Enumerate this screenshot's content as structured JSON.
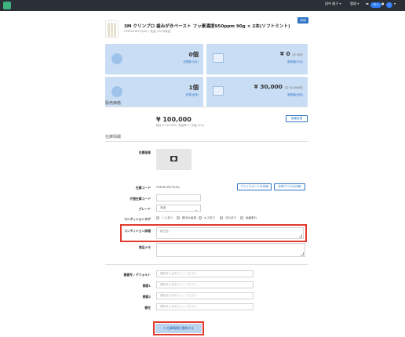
{
  "topbar": {
    "user": "田中 隆子",
    "menu": "管理",
    "badge1": "99+",
    "badge2": "1"
  },
  "product": {
    "title": "3M クリンプロ 歯みがきペースト フッ素濃度950ppm 90g × 2本(ソフトミント)",
    "sub": "ITM4DTW0TQXQ / 衣品 / EC共有品",
    "edit_label": "詳細"
  },
  "stats": [
    {
      "value": "0個",
      "label": "在庫数(今月)"
    },
    {
      "value": "¥ 0",
      "value_small": "(平 0/件)",
      "label": "販売額(今月)"
    },
    {
      "value": "1個",
      "label": "在庫(全体)"
    },
    {
      "value": "¥ 30,000",
      "value_small": "(平 30,000/件)",
      "label": "販売額(全体)"
    }
  ],
  "sections": {
    "price_title": "販売価格",
    "inventory_title": "在庫情報"
  },
  "price": {
    "amount": "¥ 100,000",
    "sub": "税込 ¥ 110,000 / 利益率 0 / 利益 (0%)",
    "change_button": "価格変更"
  },
  "fields": {
    "image_label": "在庫画像",
    "code_label": "在庫コード",
    "code_value": "ITM4DTW0TQXQ",
    "print_price_button": "プライスカードを印刷",
    "print_label_button": "在庫ラベルを印刷",
    "alt_code_label": "代替在庫コード",
    "grade_label": "グレード",
    "grade_value": "未品",
    "condition_tag_label": "コンディションタグ",
    "condition_tags": [
      "シミあり",
      "箱汚れ破損",
      "キズあり",
      "汚れあり",
      "画面割れ"
    ],
    "condition_detail_label": "コンディション詳細",
    "condition_detail_value": "新古品",
    "note_label": "商品メモ",
    "shelf_label": "棚番号 / デフォルト",
    "shelf_placeholder": "選択またはおさしくください",
    "shelf1_label": "棚番1",
    "shelf2_label": "棚番2",
    "shelf3_label": "棚在",
    "submit_button": "在庫情報を更新する"
  }
}
